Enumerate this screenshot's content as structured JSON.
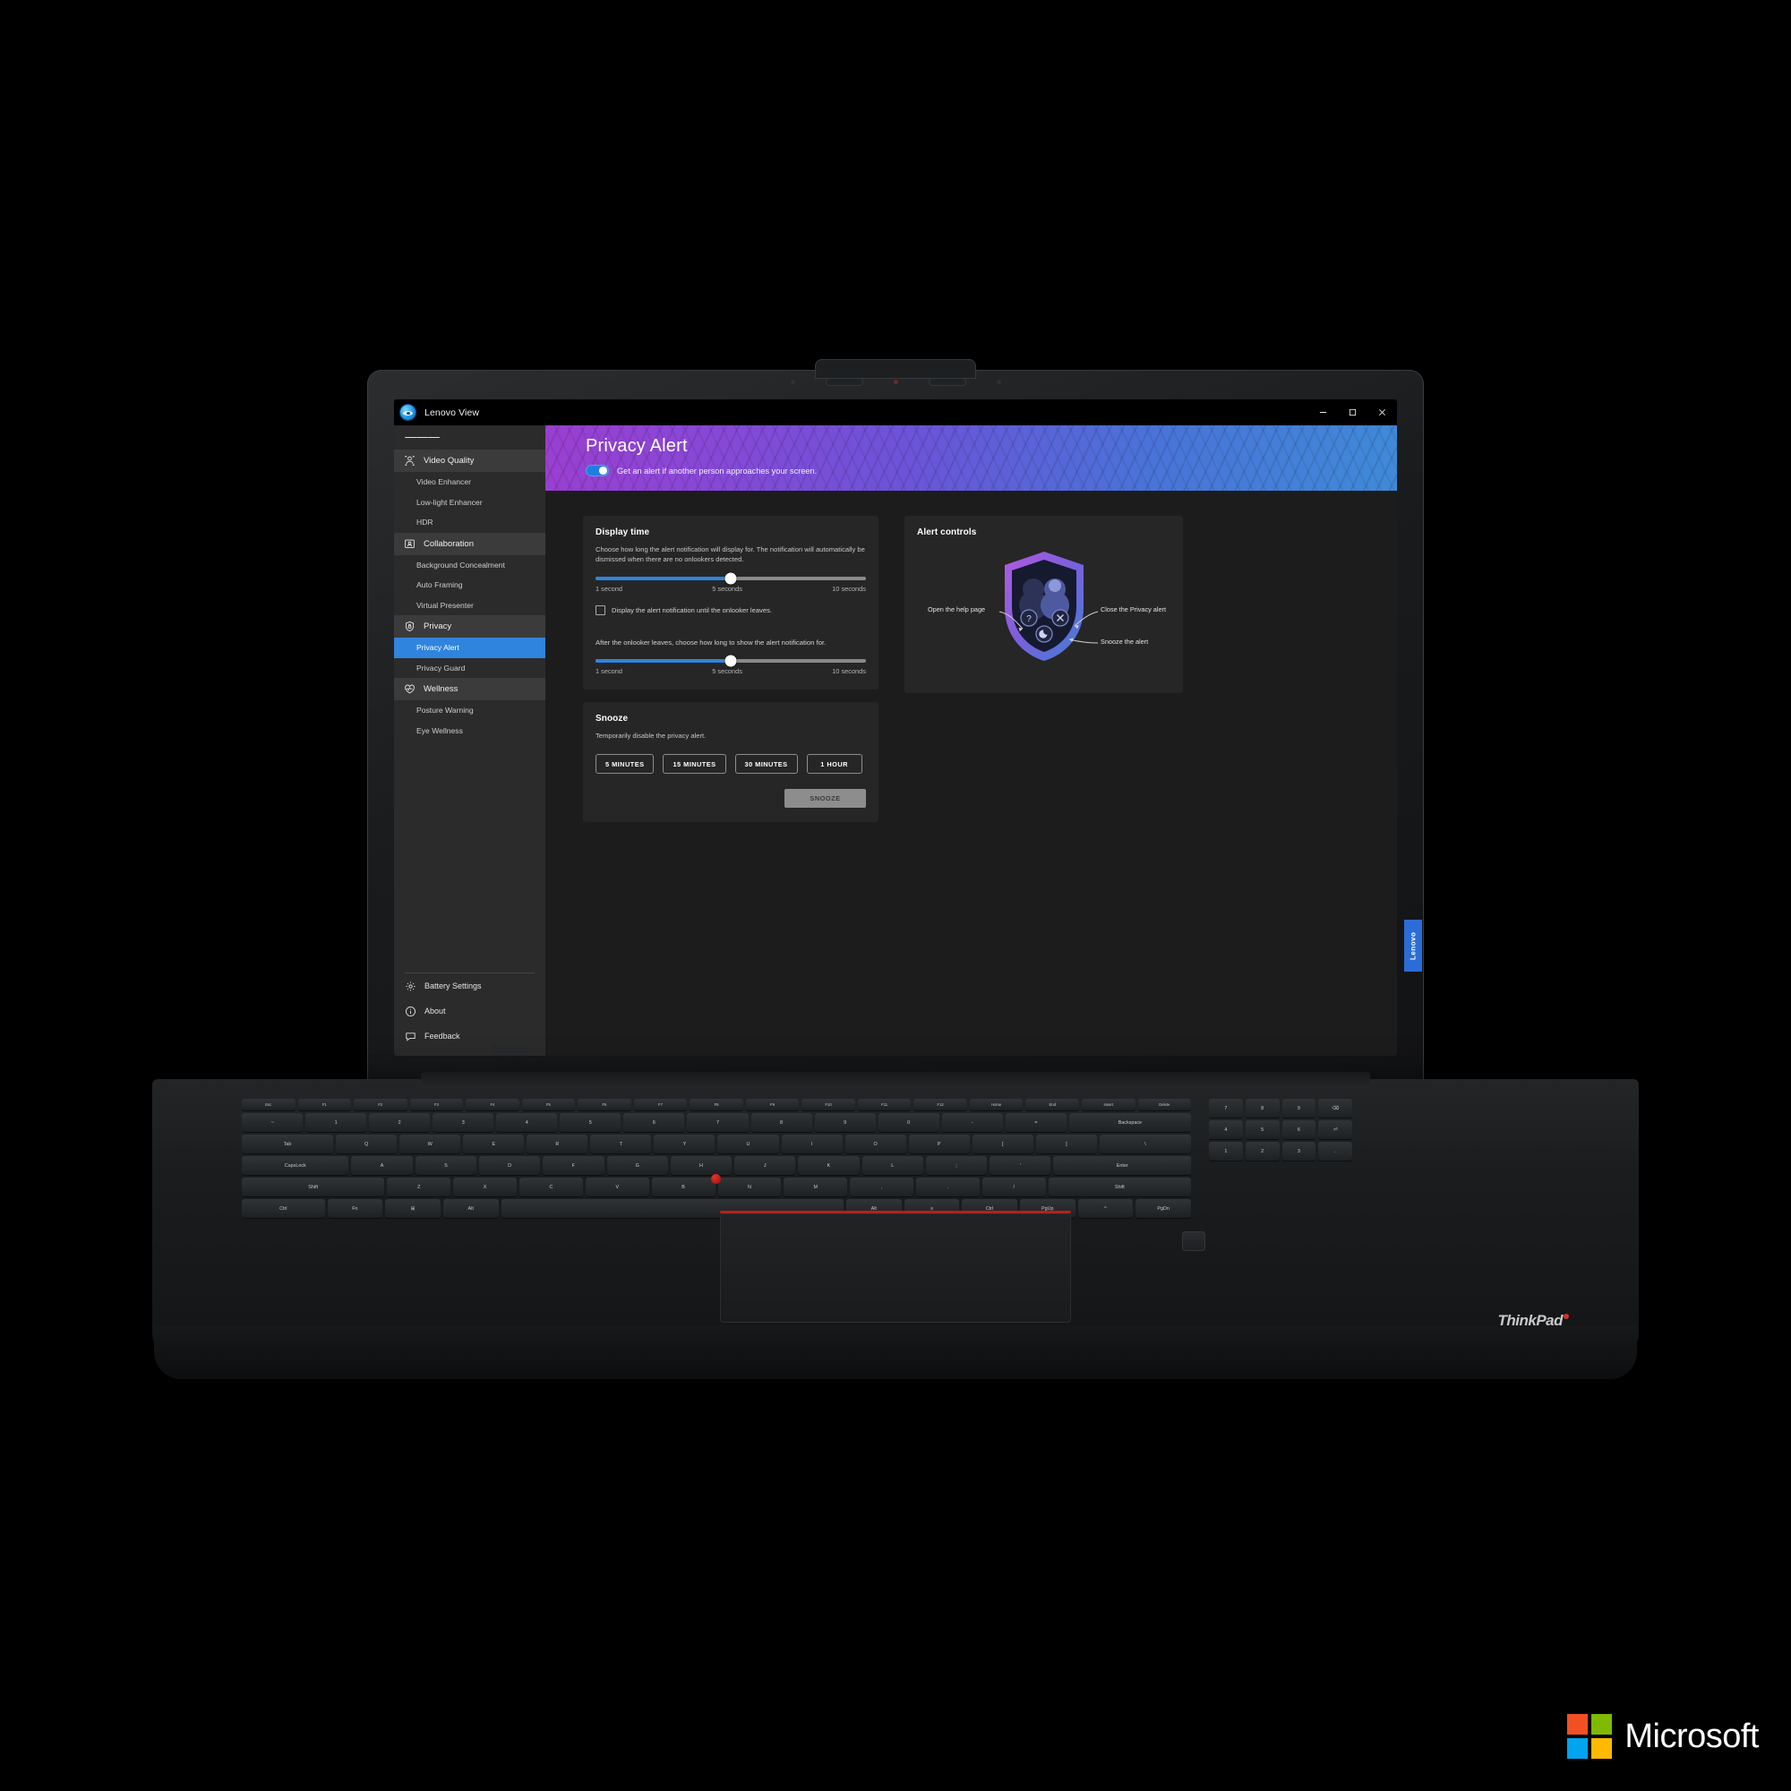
{
  "window": {
    "app_title": "Lenovo View",
    "logo_icon": "lenovo-view-eye-icon",
    "minimize_label": "Minimize",
    "maximize_label": "Restore",
    "close_label": "Close"
  },
  "sidebar": {
    "menu_icon": "hamburger-menu-icon",
    "groups": [
      {
        "label": "Video Quality",
        "icon": "camera-person-icon",
        "items": [
          {
            "label": "Video Enhancer",
            "active": false
          },
          {
            "label": "Low-light Enhancer",
            "active": false
          },
          {
            "label": "HDR",
            "active": false
          }
        ]
      },
      {
        "label": "Collaboration",
        "icon": "presenter-screen-icon",
        "items": [
          {
            "label": "Background Concealment",
            "active": false
          },
          {
            "label": "Auto Framing",
            "active": false
          },
          {
            "label": "Virtual Presenter",
            "active": false
          }
        ]
      },
      {
        "label": "Privacy",
        "icon": "shield-lock-icon",
        "items": [
          {
            "label": "Privacy Alert",
            "active": true
          },
          {
            "label": "Privacy Guard",
            "active": false
          }
        ]
      },
      {
        "label": "Wellness",
        "icon": "heart-pulse-icon",
        "items": [
          {
            "label": "Posture Warning",
            "active": false
          },
          {
            "label": "Eye Wellness",
            "active": false
          }
        ]
      }
    ],
    "bottom_items": [
      {
        "label": "Battery Settings",
        "icon": "gear-icon"
      },
      {
        "label": "About",
        "icon": "info-circle-icon"
      },
      {
        "label": "Feedback",
        "icon": "chat-bubble-icon"
      }
    ]
  },
  "hero": {
    "title": "Privacy Alert",
    "toggle_on": true,
    "toggle_label": "Get an alert if another person approaches your screen.",
    "gradient_start": "#9a3fd0",
    "gradient_end": "#3f8ad8"
  },
  "display_time": {
    "title": "Display time",
    "description": "Choose how long the alert notification will display for. The notification will automatically be dismissed when there are no onlookers detected.",
    "slider_1": {
      "min_label": "1 second",
      "mid_label": "5 seconds",
      "max_label": "10 seconds",
      "value": 5,
      "min": 1,
      "max": 10,
      "fill_percent": 50
    },
    "checkbox": {
      "label": "Display the alert notification until the onlooker leaves.",
      "checked": false
    },
    "after_text": "After the onlooker leaves, choose how long to show the alert notification for.",
    "slider_2": {
      "min_label": "1 second",
      "mid_label": "5 seconds",
      "max_label": "10 seconds",
      "value": 5,
      "min": 1,
      "max": 10,
      "fill_percent": 50
    }
  },
  "snooze": {
    "title": "Snooze",
    "description": "Temporarily disable the privacy alert.",
    "options": [
      "5 MINUTES",
      "15 MINUTES",
      "30 MINUTES",
      "1 HOUR"
    ],
    "action_label": "SNOOZE"
  },
  "alert_controls": {
    "title": "Alert controls",
    "annotations": {
      "help": "Open the help page",
      "close": "Close the Privacy alert",
      "snooze": "Snooze the alert"
    },
    "icons": {
      "help": "question-mark-icon",
      "close": "close-x-icon",
      "snooze": "moon-snooze-icon"
    }
  },
  "device": {
    "brand_badge": "Lenovo",
    "deck_logo": "ThinkPad"
  },
  "footer": {
    "brand": "Microsoft",
    "squares": [
      "#f25022",
      "#7fba00",
      "#00a4ef",
      "#ffb900"
    ]
  },
  "colors": {
    "accent_blue": "#2f84de",
    "sidebar_bg": "#2b2b2b",
    "card_bg": "#262626",
    "main_bg": "#1c1c1c"
  }
}
